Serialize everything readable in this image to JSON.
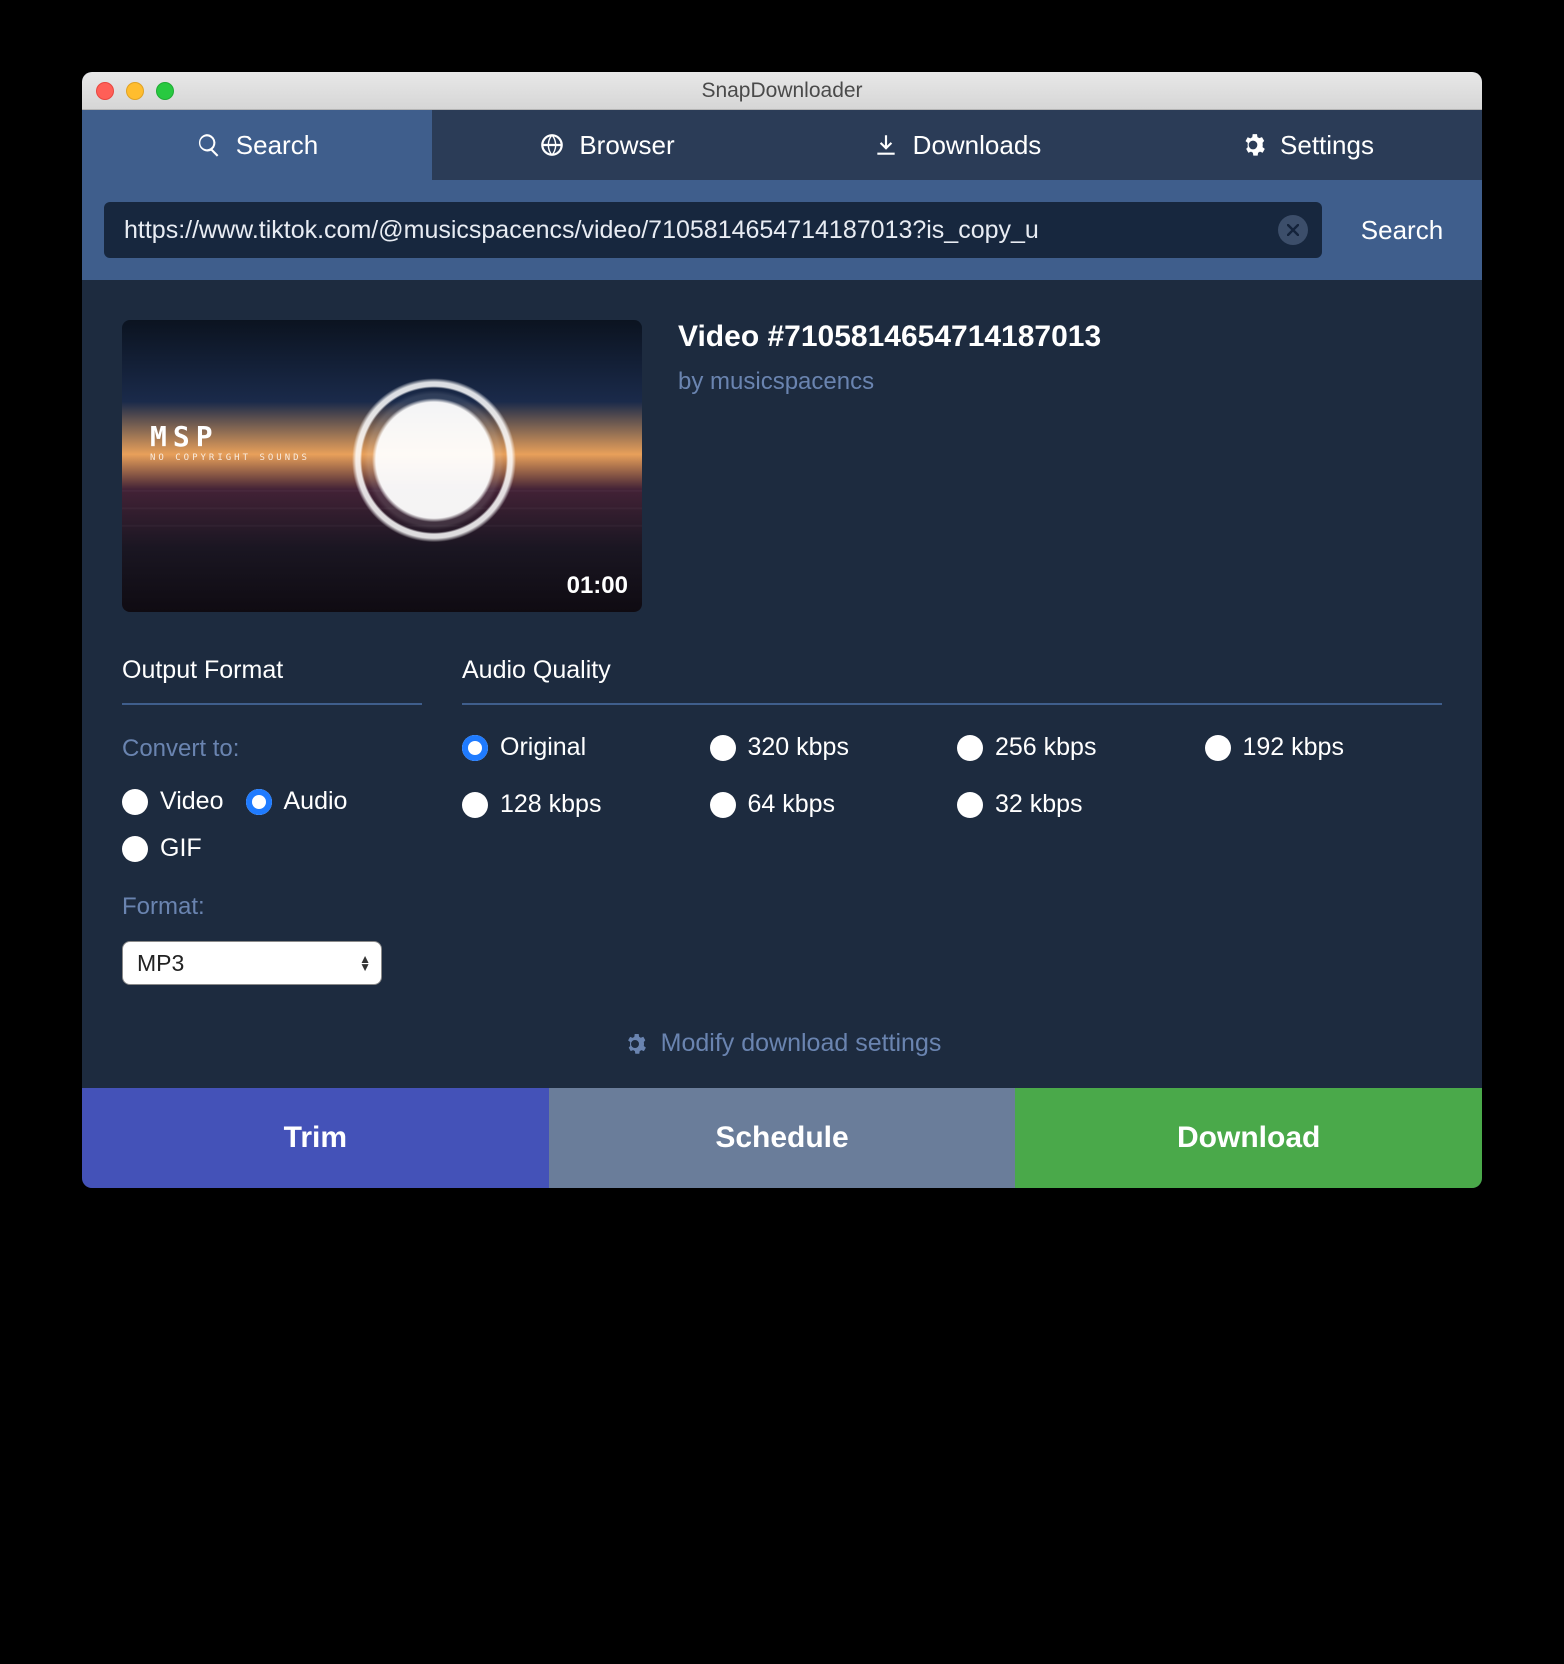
{
  "window": {
    "title": "SnapDownloader"
  },
  "tabs": {
    "search": "Search",
    "browser": "Browser",
    "downloads": "Downloads",
    "settings": "Settings"
  },
  "search": {
    "url": "https://www.tiktok.com/@musicspacencs/video/7105814654714187013?is_copy_u",
    "button": "Search"
  },
  "video": {
    "title": "Video #7105814654714187013",
    "by": "by musicspacencs",
    "duration": "01:00"
  },
  "output": {
    "heading": "Output Format",
    "convert_label": "Convert to:",
    "types": {
      "video": "Video",
      "audio": "Audio",
      "gif": "GIF"
    },
    "selected_type": "audio",
    "format_label": "Format:",
    "format_value": "MP3"
  },
  "quality": {
    "heading": "Audio Quality",
    "options": [
      "Original",
      "320 kbps",
      "256 kbps",
      "192 kbps",
      "128 kbps",
      "64 kbps",
      "32 kbps"
    ],
    "selected": "Original"
  },
  "modify_link": "Modify download settings",
  "footer": {
    "trim": "Trim",
    "schedule": "Schedule",
    "download": "Download"
  }
}
